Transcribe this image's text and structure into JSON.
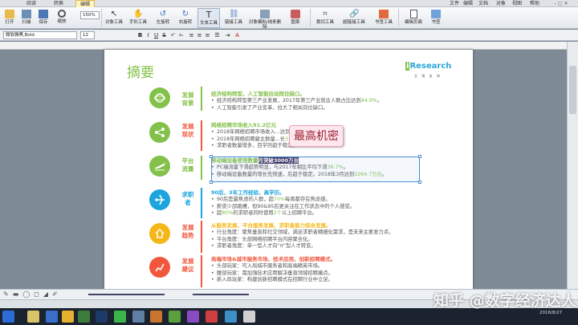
{
  "menubar": {
    "tabs": [
      "阅读",
      "转换",
      "编辑"
    ],
    "active_tab": "编辑",
    "right_menu": [
      "文件",
      "编辑",
      "文档",
      "对象",
      "视图",
      "帮助"
    ]
  },
  "ribbon": {
    "buttons": [
      "打开",
      "扫描",
      "保存",
      "缩放",
      "对象工具",
      "手形工具",
      "左旋转",
      "右旋转",
      "文本工具",
      "链接工具",
      "对象模拟/线条删除",
      "图章",
      "裁切工具",
      "超链接工具",
      "书签工具",
      "编辑页面",
      "书签"
    ],
    "zoom": "150%",
    "selected": "文本工具"
  },
  "format_bar": {
    "font": "微软雅黑,Bold",
    "size": "12",
    "buttons": [
      "B",
      "I",
      "U",
      "S",
      "x²",
      "x₂"
    ]
  },
  "document": {
    "title": "摘要",
    "logo": "iResearch",
    "logo_sub": "艾 瑞 咨 询",
    "sections": [
      {
        "category": "发展背景",
        "heading": "经济结构转型，人工智能拉动岗位缺口。",
        "items": [
          "经济结构转型第三产业发展，2017年第三产业就业人数占比达到44.9%。",
          "人工智能引发了产业变革，拉大了相关岗位缺口。"
        ],
        "color": "#83c14a"
      },
      {
        "category": "发展现状",
        "heading": "网络招聘市场收入91.2亿元",
        "items": [
          "2018年网络招聘市场收入...达到31%。",
          "2018年网络招聘雇主数量...长3.5%。",
          "求职者数量增多，目学历趋于稳定。"
        ],
        "color": "#f0573d"
      },
      {
        "category": "平台流量",
        "heading": "移动端设备使用数量",
        "heading_highlight": "月突破3000万台",
        "items": [
          "PC端流量下滑趋势明显，与2017年相比平均下滑36.7%。",
          "移动端设备数量的增长先快速，后趋于稳定。2018年3月达到3264.7万台。"
        ],
        "color": "#83c14a"
      },
      {
        "category": "求职者",
        "heading": "90后，3年工作经验，高学历。",
        "items": [
          "90后是最焦虑的人群，超70%每周都存在焦虑感。",
          "薪资少部跳槽，但90&95后更关注在工作状态中的个人感受。",
          "超80%的求职者同时使用2个以上招聘平台。"
        ],
        "color": "#1ca4dd"
      },
      {
        "category": "发展趋势",
        "heading": "从服务发展、平台服务发展、求职者能力综合发展。",
        "items": [
          "行业角度：聚焦垂直和社交领域，满足求职者精细化需求，是未来主要发力点。",
          "平台角度：头部网络招聘平台内容聚合化。",
          "求职者角度：单一型人才向“π”型人才转变。"
        ],
        "color": "#f5b718"
      },
      {
        "category": "发展建议",
        "heading": "局端市场&城市服务市场、技术应用、创新招聘模式。",
        "items": [
          "头部玩家：可入局城市服务者和高端精英市场。",
          "腰部玩家：需加强技术应用解决垂直领域招聘痛点。",
          "新入局玩家：构建创新招聘模式在招聘行业中立足。"
        ],
        "color": "#f0573d"
      }
    ],
    "popup": "最高机密"
  },
  "taskbar": {
    "time": "",
    "date": "2018/8/27"
  },
  "watermark": "知乎 @数字经济达人"
}
